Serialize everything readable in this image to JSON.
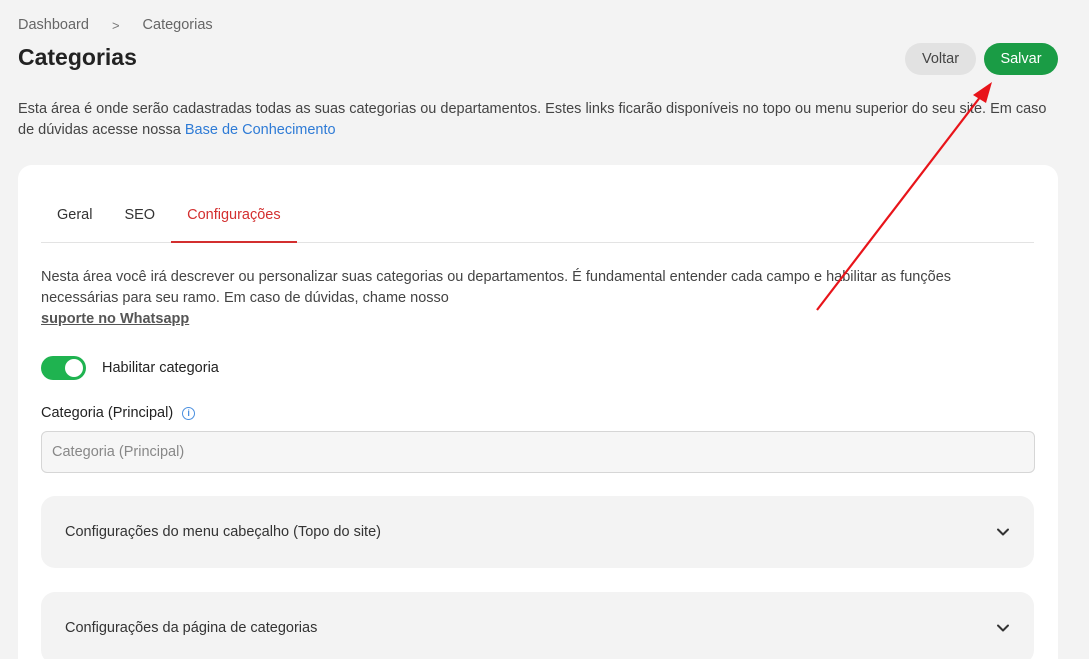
{
  "breadcrumb": {
    "items": [
      "Dashboard",
      "Categorias"
    ],
    "separator": ">"
  },
  "page": {
    "title": "Categorias",
    "intro_text": "Esta área é onde serão cadastradas todas as suas categorias ou departamentos. Estes links ficarão disponíveis no topo ou menu superior do seu site. Em caso de dúvidas acesse nossa ",
    "intro_link": "Base de Conhecimento"
  },
  "actions": {
    "back_label": "Voltar",
    "save_label": "Salvar"
  },
  "tabs": [
    {
      "label": "Geral",
      "active": false
    },
    {
      "label": "SEO",
      "active": false
    },
    {
      "label": "Configurações",
      "active": true
    }
  ],
  "config": {
    "description": "Nesta área você irá descrever ou personalizar suas categorias ou departamentos. É fundamental entender cada campo e habilitar as funções necessárias para seu ramo. Em caso de dúvidas, chame nosso",
    "support_link": " suporte no Whatsapp",
    "toggle": {
      "label": "Habilitar categoria",
      "on": true
    },
    "field": {
      "label": "Categoria (Principal)",
      "placeholder": "Categoria (Principal)",
      "value": ""
    },
    "accordions": [
      {
        "label": "Configurações do menu cabeçalho (Topo do site)"
      },
      {
        "label": "Configurações da página de categorias"
      }
    ]
  },
  "colors": {
    "accent_red": "#d32f2f",
    "save_green": "#1a9c45",
    "toggle_green": "#1fb350",
    "link_blue": "#2e7bd6",
    "annotation_arrow": "#e8141a"
  },
  "icons": {
    "breadcrumb_separator": "chevron-right-icon",
    "info": "info-icon",
    "accordion": "chevron-down-icon"
  }
}
